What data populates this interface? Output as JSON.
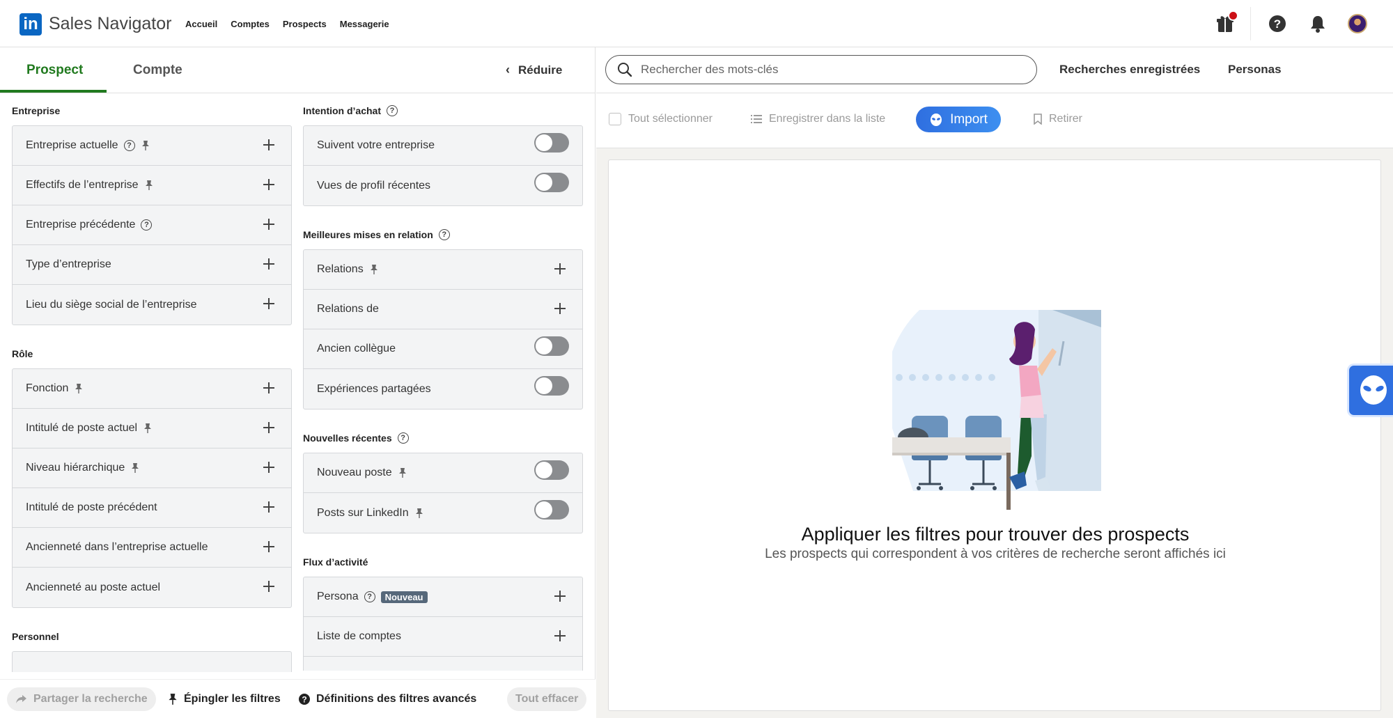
{
  "header": {
    "logo_letters": "in",
    "app_name": "Sales Navigator",
    "nav": [
      "Accueil",
      "Comptes",
      "Prospects",
      "Messagerie"
    ]
  },
  "tabs": {
    "prospect": "Prospect",
    "compte": "Compte",
    "reduce": "Réduire"
  },
  "filters": {
    "entreprise": {
      "title": "Entreprise",
      "rows": [
        "Entreprise actuelle",
        "Effectifs de l’entreprise",
        "Entreprise précédente",
        "Type d’entreprise",
        "Lieu du siège social de l’entreprise"
      ]
    },
    "role": {
      "title": "Rôle",
      "rows": [
        "Fonction",
        "Intitulé de poste actuel",
        "Niveau hiérarchique",
        "Intitulé de poste précédent",
        "Ancienneté dans l’entreprise actuelle",
        "Ancienneté au poste actuel"
      ]
    },
    "personnel": {
      "title": "Personnel"
    },
    "intention": {
      "title": "Intention d’achat",
      "rows": [
        "Suivent votre entreprise",
        "Vues de profil récentes"
      ]
    },
    "relations": {
      "title": "Meilleures mises en relation",
      "rows": [
        "Relations",
        "Relations de",
        "Ancien collègue",
        "Expériences partagées"
      ]
    },
    "nouvelles": {
      "title": "Nouvelles récentes",
      "rows": [
        "Nouveau poste",
        "Posts sur LinkedIn"
      ]
    },
    "flux": {
      "title": "Flux d’activité",
      "rows": [
        "Persona",
        "Liste de comptes"
      ],
      "new_badge": "Nouveau"
    }
  },
  "bottom": {
    "share": "Partager la recherche",
    "pin": "Épingler les filtres",
    "definitions": "Définitions des filtres avancés",
    "clear": "Tout effacer"
  },
  "search": {
    "placeholder": "Rechercher des mots-clés",
    "saved": "Recherches enregistrées",
    "personas": "Personas"
  },
  "toolbar": {
    "select_all": "Tout sélectionner",
    "save_list": "Enregistrer dans la liste",
    "import": "Import",
    "remove": "Retirer"
  },
  "empty": {
    "title": "Appliquer les filtres pour trouver des prospects",
    "subtitle": "Les prospects qui correspondent à vos critères de recherche seront affichés ici"
  },
  "colors": {
    "linkedin_blue": "#0a66c2",
    "active_tab": "#217a1f",
    "import_blue": "#2f6fe0"
  }
}
